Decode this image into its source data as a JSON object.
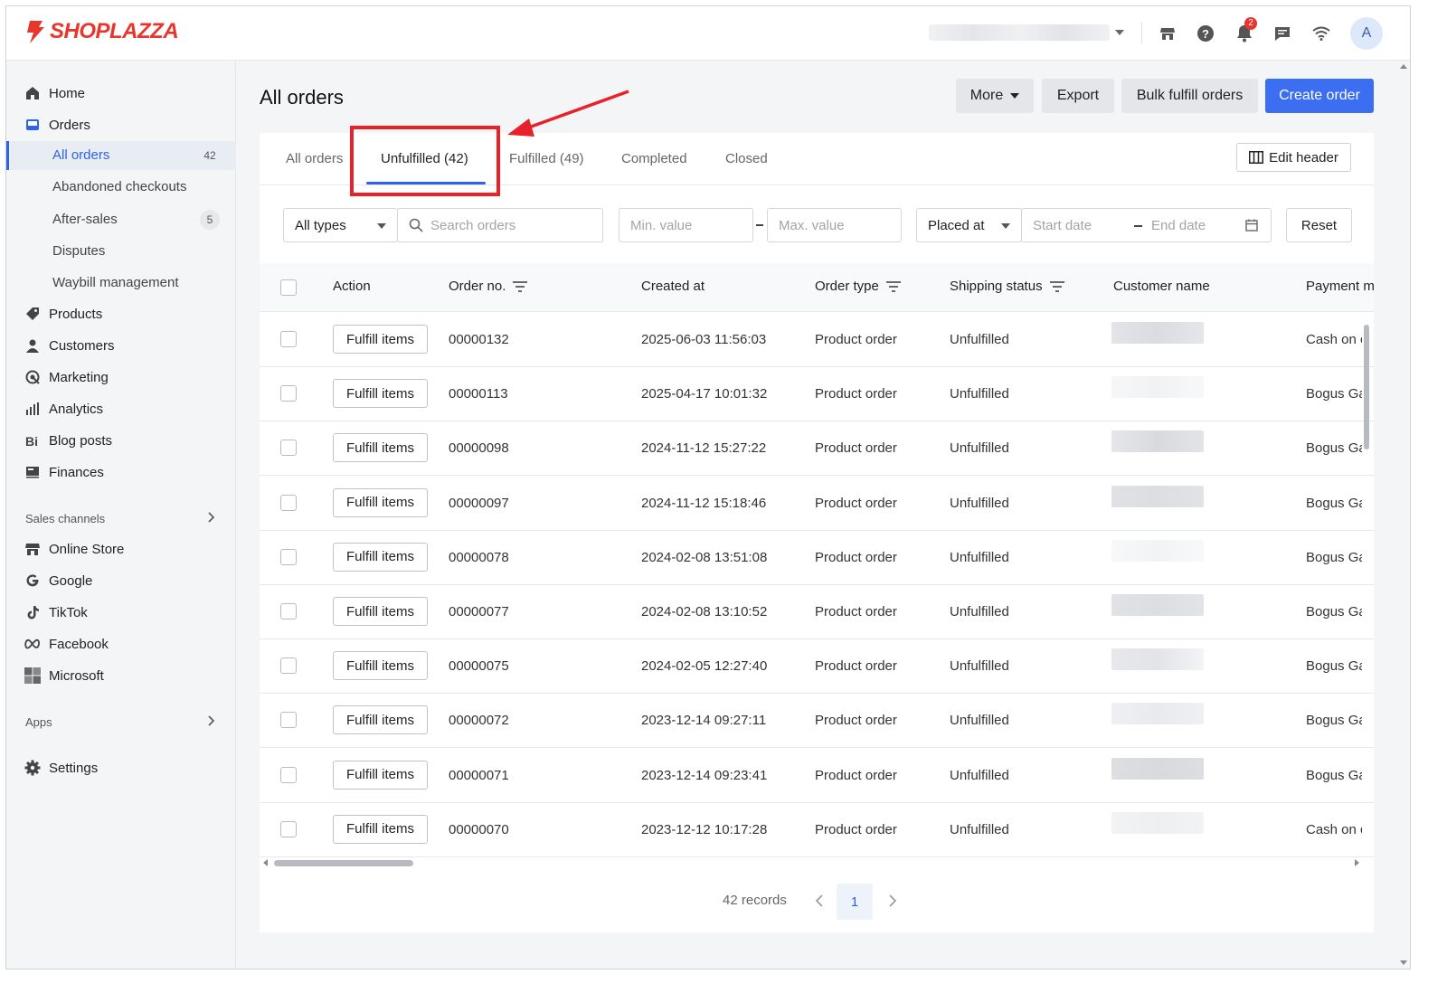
{
  "brand": {
    "name": "SHOPLAZZA",
    "color": "#e8362f"
  },
  "topbar": {
    "icons": [
      "store-icon",
      "help-icon",
      "bell-icon",
      "chat-icon",
      "wifi-icon"
    ],
    "notification_count": "2",
    "avatar_initial": "A"
  },
  "sidebar": {
    "items": [
      {
        "label": "Home",
        "icon": "home-icon"
      },
      {
        "label": "Orders",
        "icon": "orders-icon"
      },
      {
        "label": "Products",
        "icon": "tag-icon"
      },
      {
        "label": "Customers",
        "icon": "person-icon"
      },
      {
        "label": "Marketing",
        "icon": "megaphone-icon"
      },
      {
        "label": "Analytics",
        "icon": "bar-chart-icon"
      },
      {
        "label": "Blog posts",
        "icon": "blog-icon"
      },
      {
        "label": "Finances",
        "icon": "finance-icon"
      }
    ],
    "order_subitems": [
      {
        "label": "All orders",
        "count": "42"
      },
      {
        "label": "Abandoned checkouts",
        "count": ""
      },
      {
        "label": "After-sales",
        "count": "5"
      },
      {
        "label": "Disputes",
        "count": ""
      },
      {
        "label": "Waybill management",
        "count": ""
      }
    ],
    "sales_channels_label": "Sales channels",
    "channels": [
      {
        "label": "Online Store",
        "icon": "store-icon"
      },
      {
        "label": "Google",
        "icon": "google-icon"
      },
      {
        "label": "TikTok",
        "icon": "tiktok-icon"
      },
      {
        "label": "Facebook",
        "icon": "meta-icon"
      },
      {
        "label": "Microsoft",
        "icon": "microsoft-icon"
      }
    ],
    "apps_label": "Apps",
    "settings_label": "Settings"
  },
  "page": {
    "title": "All orders",
    "buttons": {
      "more": "More",
      "export": "Export",
      "bulk": "Bulk fulfill orders",
      "create": "Create order"
    }
  },
  "tabs": [
    "All orders",
    "Unfulfilled  (42)",
    "Fulfilled  (49)",
    "Completed",
    "Closed"
  ],
  "edit_header_label": "Edit header",
  "filters": {
    "type": "All types",
    "search_placeholder": "Search orders",
    "min_placeholder": "Min. value",
    "max_placeholder": "Max. value",
    "date_field": "Placed at",
    "start_placeholder": "Start date",
    "end_placeholder": "End date",
    "reset": "Reset"
  },
  "table": {
    "columns": [
      "Action",
      "Order no.",
      "Created at",
      "Order type",
      "Shipping status",
      "Customer name",
      "Payment m"
    ],
    "action_label": "Fulfill items",
    "rows": [
      {
        "order": "00000132",
        "created": "2025-06-03 11:56:03",
        "type": "Product order",
        "status": "Unfulfilled",
        "payment": "Cash on c"
      },
      {
        "order": "00000113",
        "created": "2025-04-17 10:01:32",
        "type": "Product order",
        "status": "Unfulfilled",
        "payment": "Bogus Ga"
      },
      {
        "order": "00000098",
        "created": "2024-11-12 15:27:22",
        "type": "Product order",
        "status": "Unfulfilled",
        "payment": "Bogus Ga"
      },
      {
        "order": "00000097",
        "created": "2024-11-12 15:18:46",
        "type": "Product order",
        "status": "Unfulfilled",
        "payment": "Bogus Ga"
      },
      {
        "order": "00000078",
        "created": "2024-02-08 13:51:08",
        "type": "Product order",
        "status": "Unfulfilled",
        "payment": "Bogus Ga"
      },
      {
        "order": "00000077",
        "created": "2024-02-08 13:10:52",
        "type": "Product order",
        "status": "Unfulfilled",
        "payment": "Bogus Ga"
      },
      {
        "order": "00000075",
        "created": "2024-02-05 12:27:40",
        "type": "Product order",
        "status": "Unfulfilled",
        "payment": "Bogus Ga"
      },
      {
        "order": "00000072",
        "created": "2023-12-14 09:27:11",
        "type": "Product order",
        "status": "Unfulfilled",
        "payment": "Bogus Ga"
      },
      {
        "order": "00000071",
        "created": "2023-12-14 09:23:41",
        "type": "Product order",
        "status": "Unfulfilled",
        "payment": "Bogus Ga"
      },
      {
        "order": "00000070",
        "created": "2023-12-12 10:17:28",
        "type": "Product order",
        "status": "Unfulfilled",
        "payment": "Cash on c"
      }
    ]
  },
  "pagination": {
    "records": "42 records",
    "page": "1"
  },
  "colors": {
    "accent": "#2f62e8",
    "primary_button": "#3b6ef0",
    "annotation": "#e8212a"
  }
}
